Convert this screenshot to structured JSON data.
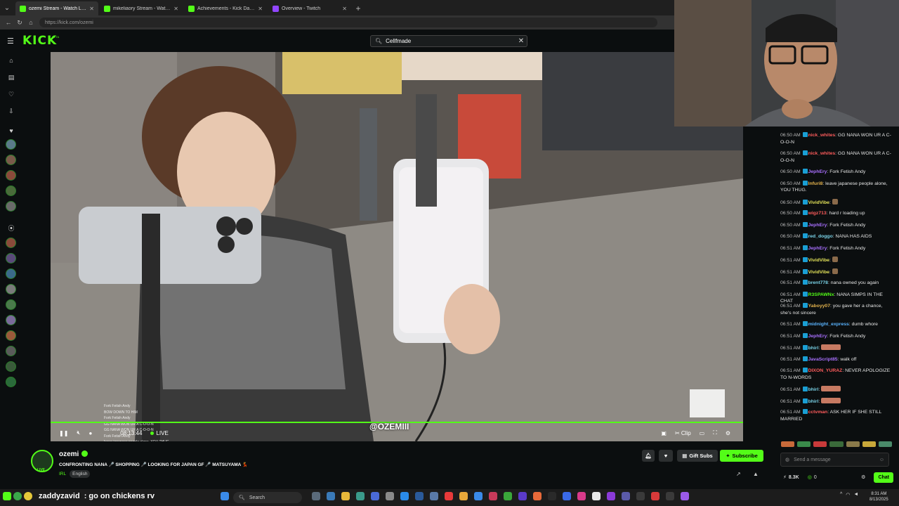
{
  "browser": {
    "tabs": [
      {
        "label": "ozemi Stream - Watch Live on Kick",
        "color": "#53fc18",
        "active": true
      },
      {
        "label": "mikeliaory Stream - Watch Liv",
        "color": "#53fc18",
        "active": false
      },
      {
        "label": "Achievements - Kick Dashboard",
        "color": "#53fc18",
        "active": false
      },
      {
        "label": "Overview - Twitch",
        "color": "#9146ff",
        "active": false
      }
    ],
    "url": "https://kick.com/ozemi"
  },
  "header": {
    "logo": "KICK",
    "beta": "BETA",
    "search_value": "Cellfmade"
  },
  "video": {
    "time": "08:13:44",
    "live": "LIVE",
    "watermark": "@OZEMIII",
    "clip": "Clip"
  },
  "overlay_chat": [
    {
      "user": "",
      "text": "Fork Fetish Andy"
    },
    {
      "user": "",
      "text": "BOW DOWN TO HIM"
    },
    {
      "user": "",
      "text": "Fork Fetish Andy"
    },
    {
      "user": "",
      "text": "GG NANA WON UR A C-O-O-N"
    },
    {
      "user": "",
      "text": "GG NANA WON UR A C-O-O-N"
    },
    {
      "user": "",
      "text": "Fork Fetish Andy"
    },
    {
      "user": "",
      "text": "leave japanese people alone, YOU THUG."
    },
    {
      "user": "",
      "text": "hard r loading up"
    },
    {
      "user": "",
      "text": "Fork Fetish Andy"
    }
  ],
  "chat": {
    "messages": [
      {
        "time": "06:50 AM",
        "user": "nick_whites",
        "color": "#ff5c5c",
        "text": "GG NANA WON UR A C-O-O-N"
      },
      {
        "time": "06:50 AM",
        "user": "nick_whites",
        "color": "#ff5c5c",
        "text": "GG NANA WON UR A C-O-O-N"
      },
      {
        "time": "06:50 AM",
        "user": "JephEry",
        "color": "#a970ff",
        "text": "Fork Fetish Andy"
      },
      {
        "time": "06:50 AM",
        "user": "Infuri8",
        "color": "#e5b44d",
        "text": "leave japanese people alone, YOU THUG."
      },
      {
        "time": "06:50 AM",
        "user": "VividVibe",
        "color": "#e5e55a",
        "text": ""
      },
      {
        "time": "06:50 AM",
        "user": "wigz713",
        "color": "#ff5c5c",
        "text": "hard r loading up"
      },
      {
        "time": "06:50 AM",
        "user": "JephEry",
        "color": "#a970ff",
        "text": "Fork Fetish Andy"
      },
      {
        "time": "06:50 AM",
        "user": "red_doggo",
        "color": "#7ad3e8",
        "text": "NANA HAS AIDS"
      },
      {
        "time": "06:51 AM",
        "user": "JephEry",
        "color": "#a970ff",
        "text": "Fork Fetish Andy"
      },
      {
        "time": "06:51 AM",
        "user": "VividVibe",
        "color": "#e5e55a",
        "text": ""
      },
      {
        "time": "06:51 AM",
        "user": "VividVibe",
        "color": "#e5e55a",
        "text": ""
      },
      {
        "time": "06:51 AM",
        "user": "brent778",
        "color": "#7ad3e8",
        "text": "nana owned you again"
      },
      {
        "time": "06:51 AM",
        "user": "R3SPAWNx",
        "color": "#53fc18",
        "text": "NANA SIMPS IN THE CHAT"
      },
      {
        "time": "06:51 AM",
        "user": "Yaboyy07",
        "color": "#e5b44d",
        "text": "you gave her a chance, she's not sincere"
      },
      {
        "time": "06:51 AM",
        "user": "midnight_express",
        "color": "#5ab4ff",
        "text": "dumb whore"
      },
      {
        "time": "06:51 AM",
        "user": "JephEry",
        "color": "#a970ff",
        "text": "Fork Fetish Andy"
      },
      {
        "time": "06:51 AM",
        "user": "bhirl",
        "color": "#7ad3e8",
        "text": ""
      },
      {
        "time": "06:51 AM",
        "user": "JavaScript85",
        "color": "#a970ff",
        "text": "walk off"
      },
      {
        "time": "06:51 AM",
        "user": "DIXON_YURAZ",
        "color": "#ff5c5c",
        "text": "NEVER APOLOGIZE TO N-WORDS"
      },
      {
        "time": "06:51 AM",
        "user": "bhirl",
        "color": "#7ad3e8",
        "text": ""
      },
      {
        "time": "06:51 AM",
        "user": "bhirl",
        "color": "#7ad3e8",
        "text": ""
      },
      {
        "time": "06:51 AM",
        "user": "cctvman",
        "color": "#ff5c5c",
        "text": "ASK HER IF SHE STILL MARRIED"
      }
    ],
    "placeholder": "Send a message",
    "viewers": "8.3K",
    "points": "0",
    "chat_button": "Chat"
  },
  "stream": {
    "channel": "ozemi",
    "title": "CONFRONTING NANA 🎤 SHOPPING 🎤 LOOKING FOR JAPAN GF 🎤 MATSUYAMA 💃",
    "category": "IRL",
    "language": "English",
    "gift_subs": "Gift Subs",
    "subscribe": "Subscribe",
    "avatar_label": "LIVE"
  },
  "taskbar": {
    "user": "zaddyzavid",
    "message": ": go on chickens rv",
    "search": "Search",
    "time": "8:31 AM",
    "date": "8/13/2025"
  }
}
